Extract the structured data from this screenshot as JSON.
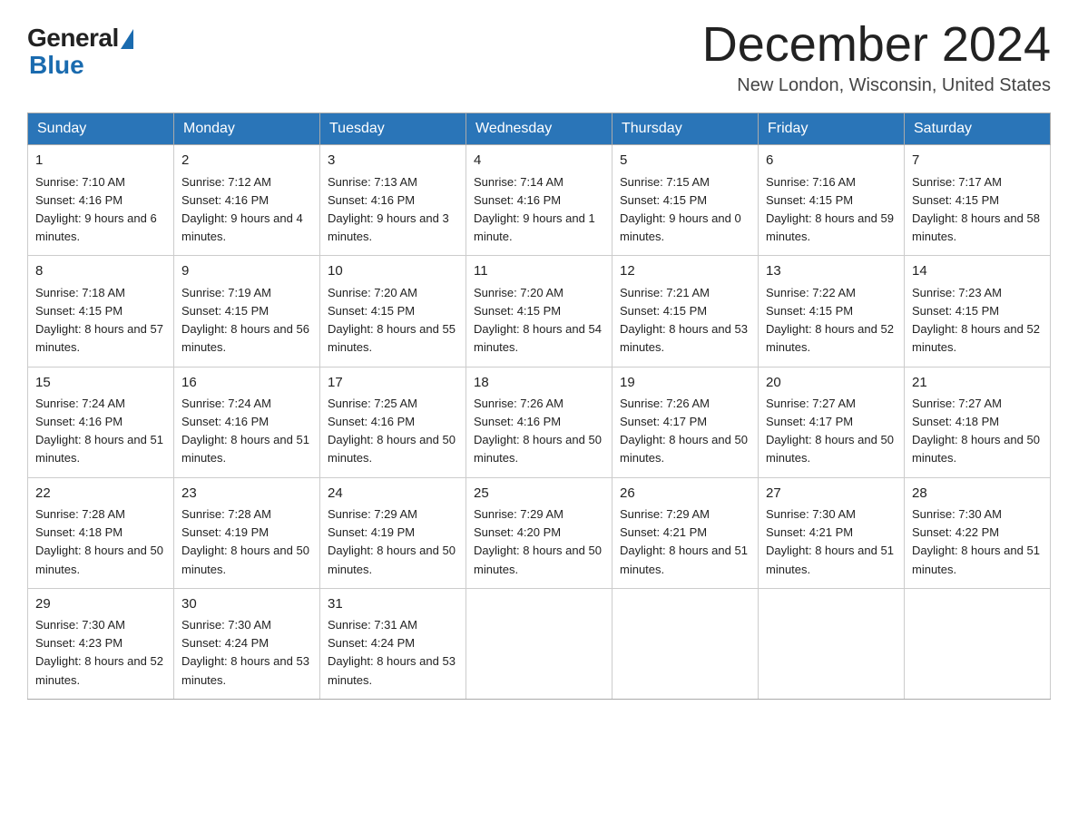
{
  "logo": {
    "general": "General",
    "blue": "Blue"
  },
  "title": "December 2024",
  "location": "New London, Wisconsin, United States",
  "days_of_week": [
    "Sunday",
    "Monday",
    "Tuesday",
    "Wednesday",
    "Thursday",
    "Friday",
    "Saturday"
  ],
  "weeks": [
    [
      {
        "day": "1",
        "sunrise": "7:10 AM",
        "sunset": "4:16 PM",
        "daylight": "9 hours and 6 minutes."
      },
      {
        "day": "2",
        "sunrise": "7:12 AM",
        "sunset": "4:16 PM",
        "daylight": "9 hours and 4 minutes."
      },
      {
        "day": "3",
        "sunrise": "7:13 AM",
        "sunset": "4:16 PM",
        "daylight": "9 hours and 3 minutes."
      },
      {
        "day": "4",
        "sunrise": "7:14 AM",
        "sunset": "4:16 PM",
        "daylight": "9 hours and 1 minute."
      },
      {
        "day": "5",
        "sunrise": "7:15 AM",
        "sunset": "4:15 PM",
        "daylight": "9 hours and 0 minutes."
      },
      {
        "day": "6",
        "sunrise": "7:16 AM",
        "sunset": "4:15 PM",
        "daylight": "8 hours and 59 minutes."
      },
      {
        "day": "7",
        "sunrise": "7:17 AM",
        "sunset": "4:15 PM",
        "daylight": "8 hours and 58 minutes."
      }
    ],
    [
      {
        "day": "8",
        "sunrise": "7:18 AM",
        "sunset": "4:15 PM",
        "daylight": "8 hours and 57 minutes."
      },
      {
        "day": "9",
        "sunrise": "7:19 AM",
        "sunset": "4:15 PM",
        "daylight": "8 hours and 56 minutes."
      },
      {
        "day": "10",
        "sunrise": "7:20 AM",
        "sunset": "4:15 PM",
        "daylight": "8 hours and 55 minutes."
      },
      {
        "day": "11",
        "sunrise": "7:20 AM",
        "sunset": "4:15 PM",
        "daylight": "8 hours and 54 minutes."
      },
      {
        "day": "12",
        "sunrise": "7:21 AM",
        "sunset": "4:15 PM",
        "daylight": "8 hours and 53 minutes."
      },
      {
        "day": "13",
        "sunrise": "7:22 AM",
        "sunset": "4:15 PM",
        "daylight": "8 hours and 52 minutes."
      },
      {
        "day": "14",
        "sunrise": "7:23 AM",
        "sunset": "4:15 PM",
        "daylight": "8 hours and 52 minutes."
      }
    ],
    [
      {
        "day": "15",
        "sunrise": "7:24 AM",
        "sunset": "4:16 PM",
        "daylight": "8 hours and 51 minutes."
      },
      {
        "day": "16",
        "sunrise": "7:24 AM",
        "sunset": "4:16 PM",
        "daylight": "8 hours and 51 minutes."
      },
      {
        "day": "17",
        "sunrise": "7:25 AM",
        "sunset": "4:16 PM",
        "daylight": "8 hours and 50 minutes."
      },
      {
        "day": "18",
        "sunrise": "7:26 AM",
        "sunset": "4:16 PM",
        "daylight": "8 hours and 50 minutes."
      },
      {
        "day": "19",
        "sunrise": "7:26 AM",
        "sunset": "4:17 PM",
        "daylight": "8 hours and 50 minutes."
      },
      {
        "day": "20",
        "sunrise": "7:27 AM",
        "sunset": "4:17 PM",
        "daylight": "8 hours and 50 minutes."
      },
      {
        "day": "21",
        "sunrise": "7:27 AM",
        "sunset": "4:18 PM",
        "daylight": "8 hours and 50 minutes."
      }
    ],
    [
      {
        "day": "22",
        "sunrise": "7:28 AM",
        "sunset": "4:18 PM",
        "daylight": "8 hours and 50 minutes."
      },
      {
        "day": "23",
        "sunrise": "7:28 AM",
        "sunset": "4:19 PM",
        "daylight": "8 hours and 50 minutes."
      },
      {
        "day": "24",
        "sunrise": "7:29 AM",
        "sunset": "4:19 PM",
        "daylight": "8 hours and 50 minutes."
      },
      {
        "day": "25",
        "sunrise": "7:29 AM",
        "sunset": "4:20 PM",
        "daylight": "8 hours and 50 minutes."
      },
      {
        "day": "26",
        "sunrise": "7:29 AM",
        "sunset": "4:21 PM",
        "daylight": "8 hours and 51 minutes."
      },
      {
        "day": "27",
        "sunrise": "7:30 AM",
        "sunset": "4:21 PM",
        "daylight": "8 hours and 51 minutes."
      },
      {
        "day": "28",
        "sunrise": "7:30 AM",
        "sunset": "4:22 PM",
        "daylight": "8 hours and 51 minutes."
      }
    ],
    [
      {
        "day": "29",
        "sunrise": "7:30 AM",
        "sunset": "4:23 PM",
        "daylight": "8 hours and 52 minutes."
      },
      {
        "day": "30",
        "sunrise": "7:30 AM",
        "sunset": "4:24 PM",
        "daylight": "8 hours and 53 minutes."
      },
      {
        "day": "31",
        "sunrise": "7:31 AM",
        "sunset": "4:24 PM",
        "daylight": "8 hours and 53 minutes."
      },
      null,
      null,
      null,
      null
    ]
  ]
}
